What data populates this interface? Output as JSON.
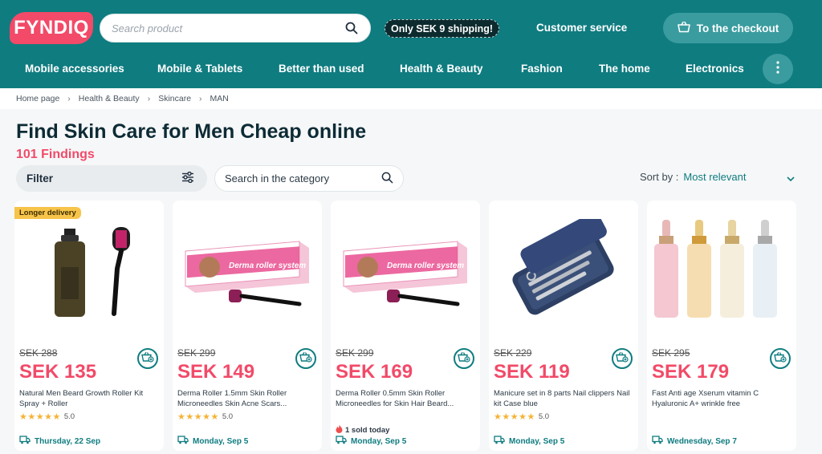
{
  "header": {
    "logo": "FYNDIQ",
    "search_placeholder": "Search product",
    "shipping_badge": "Only SEK 9 shipping!",
    "customer_service": "Customer service",
    "checkout": "To the checkout"
  },
  "nav": [
    "Mobile accessories",
    "Mobile & Tablets",
    "Better than used",
    "Health & Beauty",
    "Fashion",
    "The home",
    "Electronics"
  ],
  "breadcrumb": [
    "Home page",
    "Health & Beauty",
    "Skincare",
    "MAN"
  ],
  "page": {
    "title": "Find Skin Care for Men Cheap online",
    "count": "101 Findings",
    "filter_label": "Filter",
    "category_search_placeholder": "Search in the category",
    "sort_label": "Sort by :",
    "sort_value": "Most relevant"
  },
  "products": [
    {
      "badge": "Longer delivery",
      "old_price": "SEK 288",
      "price": "SEK 135",
      "name": "Natural Men Beard Growth Roller Kit Spray + Roller",
      "stars": "★★★★★",
      "rating": "5.0",
      "sold": "",
      "delivery": "Thursday, 22 Sep"
    },
    {
      "badge": "",
      "old_price": "SEK 299",
      "price": "SEK 149",
      "name": "Derma Roller 1.5mm Skin Roller Microneedles Skin Acne Scars...",
      "stars": "★★★★★",
      "rating": "5.0",
      "sold": "",
      "delivery": "Monday, Sep 5"
    },
    {
      "badge": "",
      "old_price": "SEK 299",
      "price": "SEK 169",
      "name": "Derma Roller 0.5mm Skin Roller Microneedles for Skin Hair Beard...",
      "stars": "",
      "rating": "",
      "sold": "1 sold today",
      "delivery": "Monday, Sep 5"
    },
    {
      "badge": "",
      "old_price": "SEK 229",
      "price": "SEK 119",
      "name": "Manicure set in 8 parts Nail clippers Nail kit Case blue",
      "stars": "★★★★★",
      "rating": "5.0",
      "sold": "",
      "delivery": "Monday, Sep 5"
    },
    {
      "badge": "",
      "old_price": "SEK 295",
      "price": "SEK 179",
      "name": "Fast Anti age Xserum vitamin C Hyaluronic A+ wrinkle free",
      "stars": "",
      "rating": "",
      "sold": "",
      "delivery": "Wednesday, Sep 7"
    }
  ],
  "product_image_text": {
    "derma_box": "Derma roller system"
  },
  "colors": {
    "brand_teal": "#0f7c80",
    "accent_pink": "#f24a68",
    "badge_yellow": "#f7c44a"
  }
}
